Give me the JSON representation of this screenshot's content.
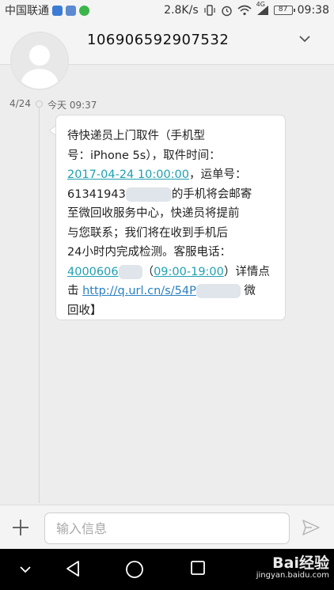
{
  "status_bar": {
    "carrier": "中国联通",
    "speed": "2.8K/s",
    "network": "4G",
    "battery": "87",
    "time": "09:38"
  },
  "header": {
    "contact_number": "106906592907532"
  },
  "message": {
    "date": "4/24",
    "time": "今天 09:37",
    "lines": {
      "l1": "待快递员上门取件（手机型",
      "l2": "号：iPhone 5s），取件时间：",
      "l3_link": "2017-04-24 10:00:00",
      "l3_rest": "，运单号：",
      "l4_a": "61341943",
      "l4_b": "的手机将会邮寄",
      "l5": "至微回收服务中心，快递员将提前",
      "l6": "与您联系；我们将在收到手机后",
      "l7": "24小时内完成检测。客服电话：",
      "l8_phone": "4000606",
      "l8_paren": "（",
      "l8_hours": "09:00-19:00",
      "l8_rest": "）详情点",
      "l9_a": "击 ",
      "l9_url": "http://q.url.cn/s/54P",
      "l9_b": " 微",
      "l10": "回收】"
    }
  },
  "input_bar": {
    "placeholder": "输入信息"
  },
  "watermark": {
    "brand": "Bai经验",
    "sub": "jingyan.baidu.com"
  },
  "colors": {
    "link": "#20a0b0",
    "url": "#2a7fc0"
  }
}
